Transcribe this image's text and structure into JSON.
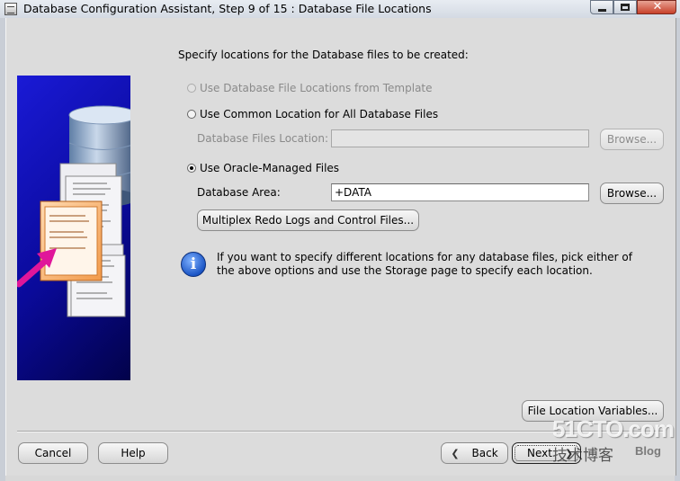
{
  "window": {
    "title": "Database Configuration Assistant, Step 9 of 15 : Database File Locations"
  },
  "main": {
    "heading": "Specify locations for the Database files to be created:",
    "options": [
      {
        "label": "Use Database File Locations from Template",
        "checked": false,
        "enabled": false
      },
      {
        "label": "Use Common Location for All Database Files",
        "checked": false,
        "enabled": true
      },
      {
        "label": "Use Oracle-Managed Files",
        "checked": true,
        "enabled": true
      }
    ],
    "common_location": {
      "label": "Database Files Location:",
      "value": "",
      "browse_label": "Browse..."
    },
    "managed": {
      "label": "Database Area:",
      "value": "+DATA",
      "browse_label": "Browse..."
    },
    "multiplex_label": "Multiplex Redo Logs and Control Files...",
    "info_text": "If you want to specify different locations for any database files, pick either of the above options and use the Storage page to specify each location.",
    "file_location_variables_label": "File Location Variables..."
  },
  "footer": {
    "cancel_label": "Cancel",
    "help_label": "Help",
    "back_label": "Back",
    "next_label": "Next"
  },
  "watermark": {
    "logo": "51CTO.com",
    "subtitle": "技术博客",
    "blog": "Blog"
  },
  "colors": {
    "side_image_blue": "#0a0a9a",
    "arrow_magenta": "#e0169a",
    "info_icon_blue": "#1c56c6"
  }
}
